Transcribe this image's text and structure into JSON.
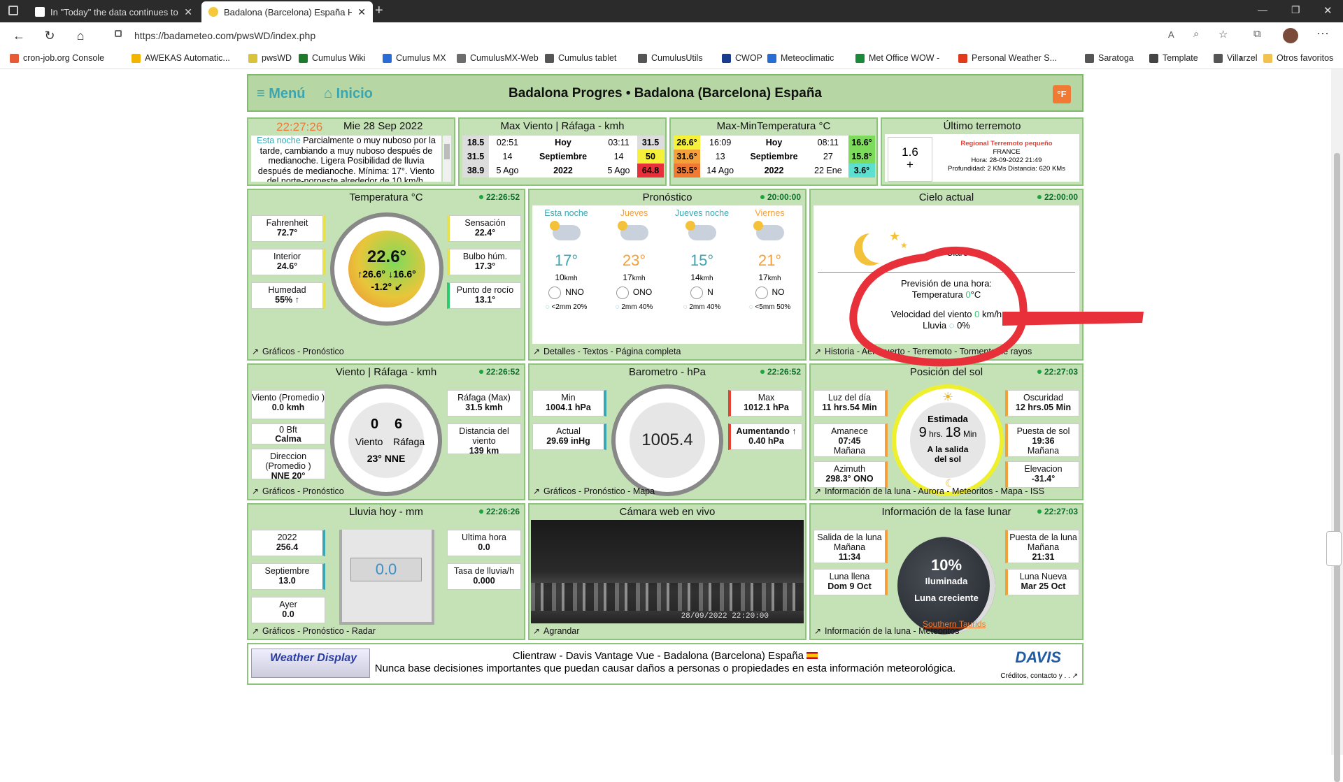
{
  "browser": {
    "tabs": [
      {
        "label": "In \"Today\" the data continues to",
        "active": false
      },
      {
        "label": "Badalona (Barcelona) España Ho",
        "active": true
      }
    ],
    "url": "https://badameteo.com/pwsWD/index.php",
    "bookmarks": [
      "cron-job.org Console",
      "AWEKAS Automatic...",
      "pwsWD",
      "Cumulus Wiki",
      "Cumulus MX",
      "CumulusMX-Web",
      "Cumulus tablet",
      "CumulusUtils",
      "CWOP",
      "Meteoclimatic",
      "Met Office WOW -",
      "Personal Weather S...",
      "Saratoga",
      "Template",
      "Villarzel"
    ],
    "other_favorites": "Otros favoritos"
  },
  "header": {
    "menu": "Menú",
    "inicio": "Inicio",
    "title": "Badalona Progres  •  Badalona (Barcelona) España",
    "unit_button": "°F"
  },
  "clock": {
    "time": "22:27:26",
    "date": "Mie 28 Sep 2022",
    "forecast_lead": "Esta noche",
    "forecast_text": "Parcialmente o muy nuboso por la tarde, cambiando a muy nuboso después de medianoche. Ligera Posibilidad de lluvia después de medianoche. Mínima: 17°. Viento del norte-noroeste alrededor de 10 km/h,"
  },
  "max_wind": {
    "title": "Max Viento | Ráfaga - kmh",
    "rows": [
      {
        "v1": "18.5",
        "t1": "02:51",
        "period": "Hoy",
        "t2": "03:11",
        "v2": "31.5"
      },
      {
        "v1": "31.5",
        "t1": "14",
        "period": "Septiembre",
        "t2": "14",
        "v2": "50"
      },
      {
        "v1": "38.9",
        "t1": "5 Ago",
        "period": "2022",
        "t2": "5 Ago",
        "v2": "64.8"
      }
    ]
  },
  "max_min_temp": {
    "title": "Max-MinTemperatura °C",
    "rows": [
      {
        "v1": "26.6°",
        "t1": "16:09",
        "period": "Hoy",
        "t2": "08:11",
        "v2": "16.6°"
      },
      {
        "v1": "31.6°",
        "t1": "13",
        "period": "Septiembre",
        "t2": "27",
        "v2": "15.8°"
      },
      {
        "v1": "35.5°",
        "t1": "14 Ago",
        "period": "2022",
        "t2": "22 Ene",
        "v2": "3.6°"
      }
    ]
  },
  "earthquake": {
    "title": "Último terremoto",
    "magnitude": "1.6",
    "type": "Regional Terremoto pequeño",
    "country": "FRANCE",
    "hour": "Hora: 28-09-2022 21:49",
    "detail": "Profundidad: 2 KMs Distancia: 620 KMs"
  },
  "temperature": {
    "title": "Temperatura °C",
    "time": "22:26:52",
    "fahrenheit_label": "Fahrenheit",
    "fahrenheit": "72.7°",
    "interior_label": "Interior",
    "interior": "24.6°",
    "humidity_label": "Humedad",
    "humidity": "55% ↑",
    "feels_label": "Sensación",
    "feels": "22.4°",
    "wetbulb_label": "Bulbo húm.",
    "wetbulb": "17.3°",
    "dew_label": "Punto de rocío",
    "dew": "13.1°",
    "current": "22.6°",
    "hi": "↑26.6°",
    "lo": "↓16.6°",
    "trend": "-1.2° ↙",
    "footer": "Gráficos - Pronóstico"
  },
  "forecast": {
    "title": "Pronóstico",
    "time": "20:00:00",
    "days": [
      {
        "name": "Esta noche",
        "temp": "17°",
        "wind": "10",
        "unit": "kmh",
        "dir": "NNO",
        "rain": "<2mm 20%",
        "color": "#3aa6b1"
      },
      {
        "name": "Jueves",
        "temp": "23°",
        "wind": "17",
        "unit": "kmh",
        "dir": "ONO",
        "rain": "2mm 40%",
        "color": "#f3a03b"
      },
      {
        "name": "Jueves noche",
        "temp": "15°",
        "wind": "14",
        "unit": "kmh",
        "dir": "N",
        "rain": "2mm 40%",
        "color": "#3aa6b1"
      },
      {
        "name": "Viernes",
        "temp": "21°",
        "wind": "17",
        "unit": "kmh",
        "dir": "NO",
        "rain": "<5mm 50%",
        "color": "#f3a03b"
      }
    ],
    "footer": "Detalles - Textos - Página completa"
  },
  "sky": {
    "title": "Cielo actual",
    "time": "22:00:00",
    "condition": "Claro",
    "hour_forecast": "Previsión de una hora:",
    "temp_line": "Temperatura",
    "temp_value": "0",
    "temp_unit": "°C",
    "wind_line": "Velocidad del viento",
    "wind_value": "0",
    "wind_unit": "km/h",
    "rain_line": "Lluvia",
    "rain_value": "0%",
    "footer": "Historia - Aeropuerto - Terremoto - Tormenta de rayos"
  },
  "wind": {
    "title": "Viento | Ráfaga - kmh",
    "time": "22:26:52",
    "avg_label": "Viento (Promedio )",
    "avg": "0.0 kmh",
    "bft": "0 Bft",
    "calm": "Calma",
    "dir_label": "Direccion (Promedio )",
    "dir": "NNE 20°",
    "gust_label": "Ráfaga (Max)",
    "gust": "31.5 kmh",
    "dist_label": "Distancia del viento",
    "dist": "139 km",
    "speed": "0",
    "speed_label": "Viento",
    "gust_now": "6",
    "gust_now_label": "Ráfaga",
    "bearing": "23° NNE",
    "footer": "Gráficos - Pronóstico"
  },
  "barometer": {
    "title": "Barometro - hPa",
    "time": "22:26:52",
    "min_label": "Min",
    "min": "1004.1 hPa",
    "now_label": "Actual",
    "now": "29.69 inHg",
    "max_label": "Max",
    "max": "1012.1 hPa",
    "trend_label": "Aumentando ↑",
    "trend": "0.40 hPa",
    "value": "1005.4",
    "footer": "Gráficos - Pronóstico - Mapa"
  },
  "sun": {
    "title": "Posición del sol",
    "time": "22:27:03",
    "daylight_label": "Luz del día",
    "daylight": "11 hrs.54 Min",
    "dawn_label": "Amanece",
    "dawn": "07:45",
    "dawn_when": "Mañana",
    "azimuth_label": "Azimuth",
    "azimuth": "298.3° ONO",
    "dark_label": "Oscuridad",
    "dark": "12 hrs.05 Min",
    "set_label": "Puesta de sol",
    "set": "19:36",
    "set_when": "Mañana",
    "elev_label": "Elevacion",
    "elev": "-31.4°",
    "est": "Estimada",
    "hrs": "9",
    "mins": "18",
    "until": "A la salida del sol",
    "footer": "Información de la luna - Aurora - Meteoritos - Mapa - ISS"
  },
  "rain": {
    "title": "Lluvia hoy - mm",
    "time": "22:26:26",
    "year_label": "2022",
    "year": "256.4",
    "month_label": "Septiembre",
    "month": "13.0",
    "yday_label": "Ayer",
    "yday": "0.0",
    "hour_label": "Ultima hora",
    "hour": "0.0",
    "rate_label": "Tasa de lluvia/h",
    "rate": "0.000",
    "today": "0.0",
    "footer": "Gráficos - Pronóstico - Radar"
  },
  "webcam": {
    "title": "Cámara web en vivo",
    "stamp": "28/09/2022 22:20:00",
    "footer": "Agrandar"
  },
  "moon": {
    "title": "Información de la fase lunar",
    "time": "22:27:03",
    "rise_label": "Salida de la luna",
    "rise_when": "Mañana",
    "rise": "11:34",
    "full_label": "Luna llena",
    "full": "Dom 9 Oct",
    "set_label": "Puesta de la luna",
    "set_when": "Mañana",
    "set": "21:31",
    "new_label": "Luna Nueva",
    "new": "Mar 25 Oct",
    "pct": "10%",
    "lit": "Iluminada",
    "phase": "Luna creciente",
    "meteor": "Southern Taurids",
    "footer": "Información de la luna - Meteoritos"
  },
  "footer": {
    "line1": "Clientraw   -  Davis Vantage Vue  -  Badalona (Barcelona) España",
    "line2": "Nunca base decisiones importantes que puedan causar daños a personas o propiedades en esta información meteorológica.",
    "wd_logo": "Weather Display",
    "davis": "DAVIS",
    "credits": "Créditos, contacto y . ."
  },
  "colors": {
    "accent": "#3aa6b1",
    "panel": "#c5e2b6",
    "border": "#8bc47a",
    "annotation": "#e8303a"
  }
}
